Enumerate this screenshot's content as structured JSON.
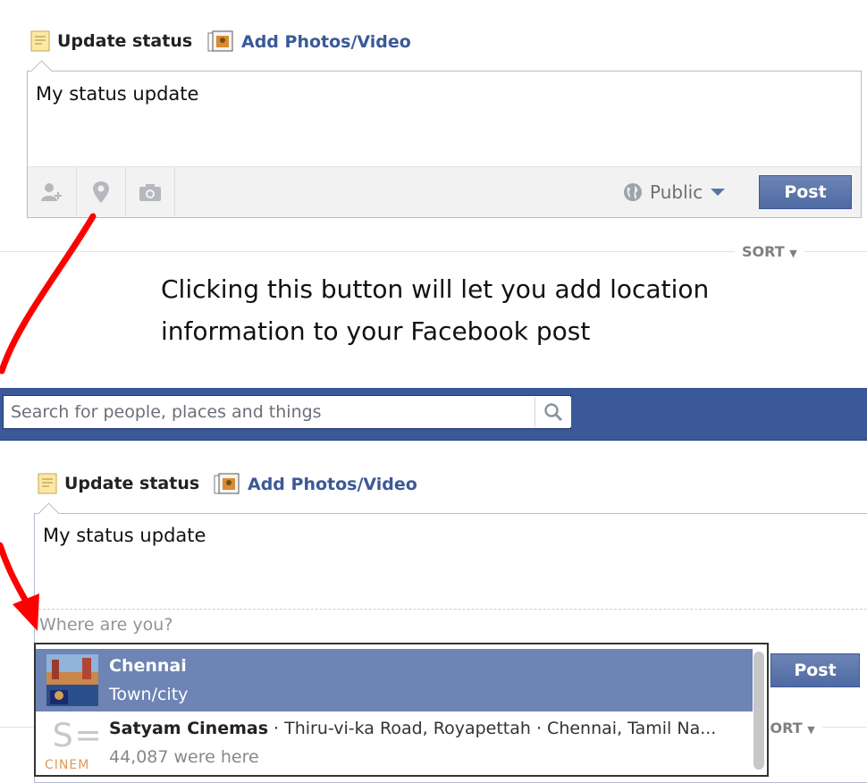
{
  "top_composer": {
    "tab_status": "Update status",
    "tab_photos": "Add Photos/Video",
    "text": "My status update",
    "privacy": "Public",
    "post": "Post"
  },
  "sort": "SORT",
  "caption_line1": "Clicking this button will let you add location",
  "caption_line2": "information to your Facebook post",
  "search": {
    "placeholder": "Search for people, places and things"
  },
  "bottom_composer": {
    "tab_status": "Update status",
    "tab_photos": "Add Photos/Video",
    "text": "My status update",
    "where_placeholder": "Where are you?",
    "post": "Post",
    "sort": "SORT"
  },
  "dropdown": {
    "items": [
      {
        "title": "Chennai",
        "sub": "Town/city"
      },
      {
        "title": "Satyam Cinemas",
        "desc": " · Thiru-vi-ka Road, Royapettah · Chennai, Tamil Na...",
        "sub": "44,087 were here",
        "logo_text": "CINEM"
      }
    ]
  },
  "colors": {
    "brand": "#3b5998",
    "post_button": "#5b74a8",
    "selected_row": "#6d84b4",
    "arrow": "#ff0000"
  },
  "icons": [
    "note-icon",
    "photo-album-icon",
    "tag-friends-icon",
    "location-pin-icon",
    "camera-icon",
    "globe-icon",
    "chevron-down-icon",
    "search-icon"
  ]
}
